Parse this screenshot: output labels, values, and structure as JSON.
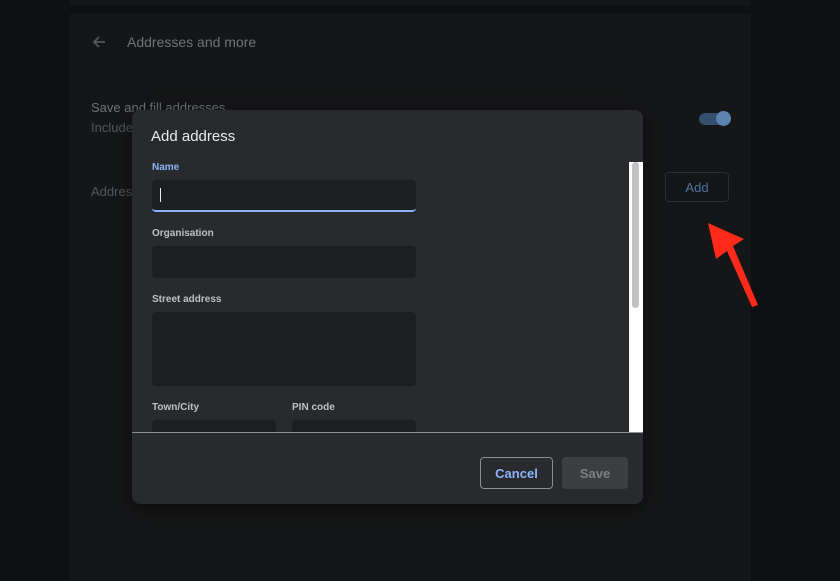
{
  "settings": {
    "page_title": "Addresses and more",
    "save_fill_title": "Save and fill addresses",
    "save_fill_subtitle": "Include",
    "save_fill_enabled": true,
    "addresses_label": "Addres",
    "add_label": "Add"
  },
  "dialog": {
    "title": "Add address",
    "fields": {
      "name": {
        "label": "Name",
        "value": ""
      },
      "organisation": {
        "label": "Organisation",
        "value": ""
      },
      "street": {
        "label": "Street address",
        "value": ""
      },
      "town": {
        "label": "Town/City",
        "value": ""
      },
      "pin": {
        "label": "PIN code",
        "value": ""
      }
    },
    "cancel_label": "Cancel",
    "save_label": "Save"
  },
  "icons": {
    "back": "back-arrow-icon",
    "annotation": "red-arrow-pointer"
  },
  "colors": {
    "accent": "#8ab4f8",
    "annotation_arrow": "#ff2a1a",
    "dialog_bg": "#292a2d"
  }
}
